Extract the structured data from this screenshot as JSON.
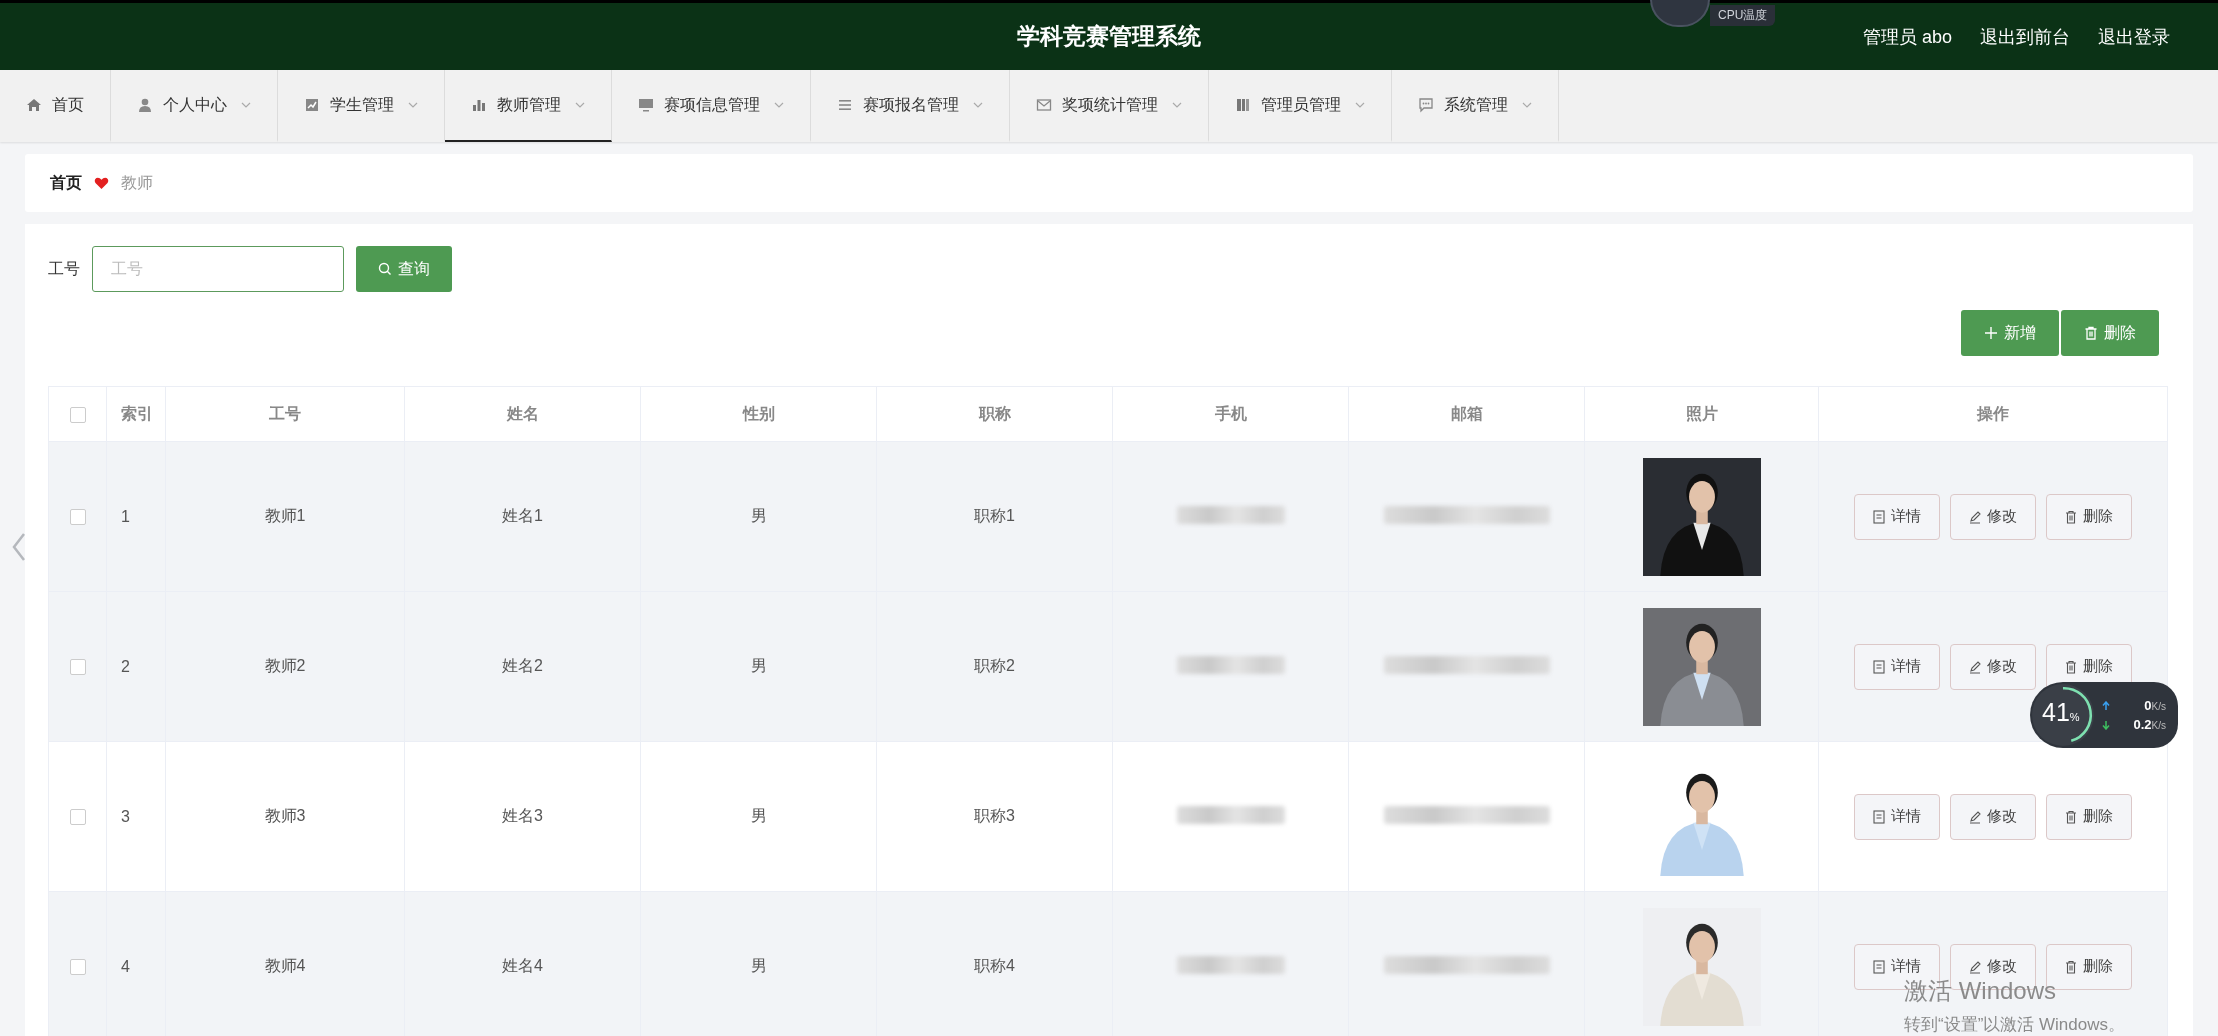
{
  "header": {
    "title": "学科竞赛管理系统",
    "links": [
      "管理员 abo",
      "退出到前台",
      "退出登录"
    ]
  },
  "cpu_widget": {
    "label": "CPU温度"
  },
  "nav": [
    {
      "label": "首页",
      "dropdown": false,
      "selected": false
    },
    {
      "label": "个人中心",
      "dropdown": true,
      "selected": false
    },
    {
      "label": "学生管理",
      "dropdown": true,
      "selected": false
    },
    {
      "label": "教师管理",
      "dropdown": true,
      "selected": true
    },
    {
      "label": "赛项信息管理",
      "dropdown": true,
      "selected": false
    },
    {
      "label": "赛项报名管理",
      "dropdown": true,
      "selected": false
    },
    {
      "label": "奖项统计管理",
      "dropdown": true,
      "selected": false
    },
    {
      "label": "管理员管理",
      "dropdown": true,
      "selected": false
    },
    {
      "label": "系统管理",
      "dropdown": true,
      "selected": false
    }
  ],
  "breadcrumb": [
    {
      "label": "首页",
      "current": false
    },
    {
      "label": "教师",
      "current": true
    }
  ],
  "search": {
    "label": "工号",
    "placeholder": "工号",
    "button": "查询"
  },
  "actions": [
    {
      "label": "新增",
      "kind": "add"
    },
    {
      "label": "删除",
      "kind": "delete"
    }
  ],
  "table": {
    "select_all": {
      "checked": false
    },
    "columns": [
      "索引",
      "工号",
      "姓名",
      "性别",
      "职称",
      "手机",
      "邮箱",
      "照片",
      "操作"
    ],
    "rows": [
      {
        "index": "1",
        "teacher_id": "教师1",
        "name": "姓名1",
        "gender": "男",
        "title": "职称1",
        "checked": false,
        "highlighted": true,
        "actions": [
          {
            "label": "详情",
            "kind": "detail"
          },
          {
            "label": "修改",
            "kind": "edit"
          },
          {
            "label": "删除",
            "kind": "delete"
          }
        ]
      },
      {
        "index": "2",
        "teacher_id": "教师2",
        "name": "姓名2",
        "gender": "男",
        "title": "职称2",
        "checked": false,
        "highlighted": true,
        "actions": [
          {
            "label": "详情",
            "kind": "detail"
          },
          {
            "label": "修改",
            "kind": "edit"
          },
          {
            "label": "删除",
            "kind": "delete"
          }
        ]
      },
      {
        "index": "3",
        "teacher_id": "教师3",
        "name": "姓名3",
        "gender": "男",
        "title": "职称3",
        "checked": false,
        "highlighted": false,
        "actions": [
          {
            "label": "详情",
            "kind": "detail"
          },
          {
            "label": "修改",
            "kind": "edit"
          },
          {
            "label": "删除",
            "kind": "delete"
          }
        ]
      },
      {
        "index": "4",
        "teacher_id": "教师4",
        "name": "姓名4",
        "gender": "男",
        "title": "职称4",
        "checked": false,
        "highlighted": true,
        "actions": [
          {
            "label": "详情",
            "kind": "detail"
          },
          {
            "label": "修改",
            "kind": "edit"
          },
          {
            "label": "删除",
            "kind": "delete"
          }
        ]
      }
    ]
  },
  "net_widget": {
    "percent": "41",
    "percent_unit": "%",
    "upload": "0",
    "upload_unit": "K/s",
    "download": "0.2",
    "download_unit": "K/s"
  },
  "activation_notice": {
    "title": "激活 Windows",
    "text": "转到“设置”以激活 Windows。"
  }
}
